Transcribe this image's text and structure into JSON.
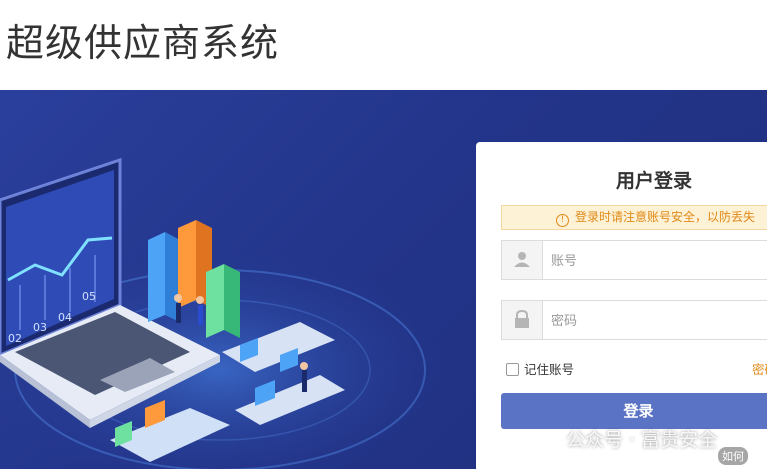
{
  "app": {
    "title": "超级供应商系统"
  },
  "login": {
    "title": "用户登录",
    "warning": "登录时请注意账号安全，以防丢失",
    "username_placeholder": "账号",
    "password_placeholder": "密码",
    "remember_label": "记住账号",
    "forgot_label": "密码",
    "submit_label": "登录"
  },
  "chart_labels": [
    "02",
    "03",
    "04",
    "05"
  ],
  "watermark": {
    "text": "公众号 · 富贵安全",
    "small": "如何"
  },
  "colors": {
    "banner": "#23358a",
    "button": "#5a73c4",
    "accent": "#e08a16"
  }
}
